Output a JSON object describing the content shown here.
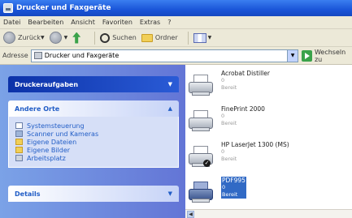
{
  "window": {
    "title": "Drucker und Faxgeräte"
  },
  "menu": [
    "Datei",
    "Bearbeiten",
    "Ansicht",
    "Favoriten",
    "Extras",
    "?"
  ],
  "toolbar": {
    "back_label": "Zurück",
    "search_label": "Suchen",
    "folders_label": "Ordner"
  },
  "address": {
    "label": "Adresse",
    "value": "Drucker und Faxgeräte",
    "go_label": "Wechseln zu"
  },
  "taskpane": {
    "printer_tasks": {
      "title": "Druckeraufgaben"
    },
    "other_places": {
      "title": "Andere Orte",
      "items": [
        {
          "label": "Systemsteuerung",
          "icon": "control-panel-icon"
        },
        {
          "label": "Scanner und Kameras",
          "icon": "scanner-icon"
        },
        {
          "label": "Eigene Dateien",
          "icon": "folder-icon"
        },
        {
          "label": "Eigene Bilder",
          "icon": "pictures-folder-icon"
        },
        {
          "label": "Arbeitsplatz",
          "icon": "computer-icon"
        }
      ]
    },
    "details": {
      "title": "Details"
    }
  },
  "printers": [
    {
      "name": "Acrobat Distiller",
      "jobs": "0",
      "status": "Bereit",
      "default": false,
      "selected": false
    },
    {
      "name": "FinePrint 2000",
      "jobs": "0",
      "status": "Bereit",
      "default": false,
      "selected": false
    },
    {
      "name": "HP LaserJet 1300 (MS)",
      "jobs": "0",
      "status": "Bereit",
      "default": true,
      "selected": false
    },
    {
      "name": "PDF995",
      "jobs": "0",
      "status": "Bereit",
      "default": false,
      "selected": true
    }
  ]
}
